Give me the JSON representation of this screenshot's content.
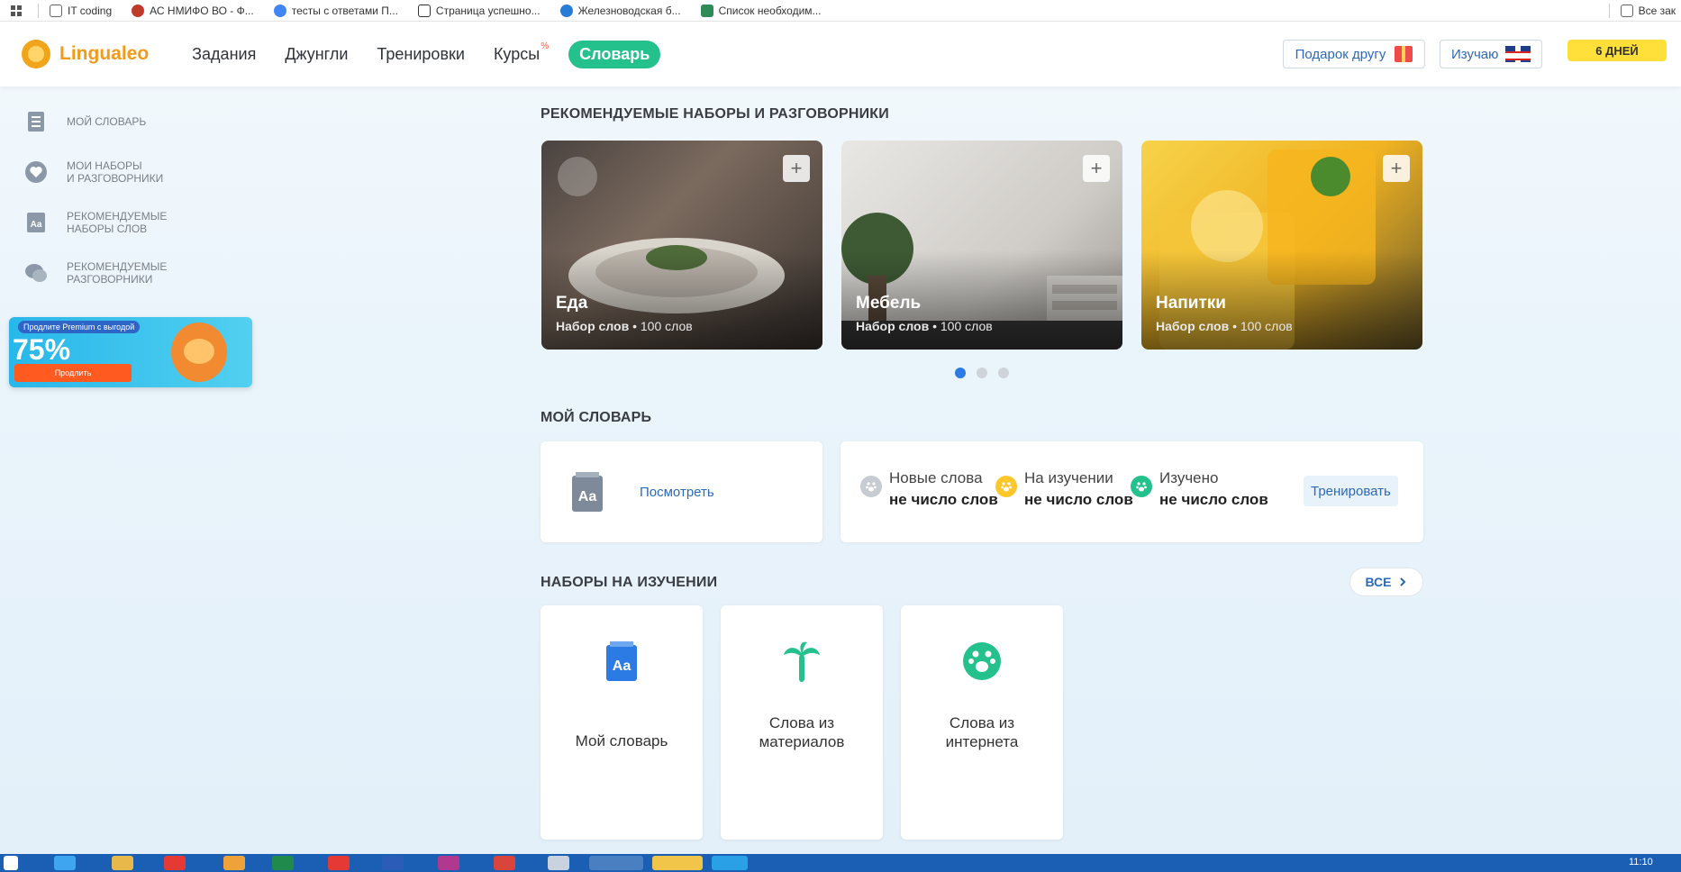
{
  "bookmarks": [
    {
      "label": "IT coding",
      "color": "#666666"
    },
    {
      "label": "АС НМИФО ВО - Ф...",
      "color": "#c0392b"
    },
    {
      "label": "тесты с ответами П...",
      "color": "#4285f4"
    },
    {
      "label": "Страница успешно...",
      "color": "#333333"
    },
    {
      "label": "Железноводская б...",
      "color": "#2a7bd6"
    },
    {
      "label": "Список необходим...",
      "color": "#2e8b57"
    }
  ],
  "bookmarks_right": "Все зак",
  "header": {
    "logo": "Lingualeo",
    "nav": [
      "Задания",
      "Джунгли",
      "Тренировки",
      "Курсы"
    ],
    "nav_badge": "%",
    "nav_active": "Словарь",
    "gift": "Подарок другу",
    "learning": "Изучаю",
    "days": "6 ДНЕЙ"
  },
  "sidebar": {
    "items": [
      {
        "label": "МОЙ СЛОВАРЬ",
        "icon": "book-icon"
      },
      {
        "label": "МОИ НАБОРЫ\nИ РАЗГОВОРНИКИ",
        "icon": "heart-icon"
      },
      {
        "label": "РЕКОМЕНДУЕМЫЕ\nНАБОРЫ СЛОВ",
        "icon": "dictionary-aa-icon"
      },
      {
        "label": "РЕКОМЕНДУЕМЫЕ\nРАЗГОВОРНИКИ",
        "icon": "chat-icon"
      }
    ],
    "promo": {
      "tag": "Продлите Premium с выгодой",
      "percent": "75%",
      "button": "Продлить"
    }
  },
  "recommended": {
    "title": "РЕКОМЕНДУЕМЫЕ НАБОРЫ И РАЗГОВОРНИКИ",
    "cards": [
      {
        "name": "Еда",
        "type": "Набор слов",
        "count": "100 слов",
        "add": "+"
      },
      {
        "name": "Мебель",
        "type": "Набор слов",
        "count": "100 слов",
        "add": "+"
      },
      {
        "name": "Напитки",
        "type": "Набор слов",
        "count": "100 слов",
        "add": "+"
      }
    ],
    "pages": 3,
    "active_page": 1
  },
  "dictionary": {
    "title": "МОЙ СЛОВАРЬ",
    "view": "Посмотреть",
    "stats": [
      {
        "label": "Новые слова",
        "value": "не число слов",
        "color": "#c7ccd3"
      },
      {
        "label": "На изучении",
        "value": "не число слов",
        "color": "#ffc72c"
      },
      {
        "label": "Изучено",
        "value": "не число слов",
        "color": "#25c18c"
      }
    ],
    "train": "Тренировать"
  },
  "learning_sets": {
    "title": "НАБОРЫ НА ИЗУЧЕНИИ",
    "all": "ВСЕ",
    "tiles": [
      {
        "label": "Мой словарь",
        "icon": "dictionary-aa-icon",
        "color": "#2c7be5"
      },
      {
        "label": "Слова из\nматериалов",
        "icon": "palm-icon",
        "color": "#25c18c"
      },
      {
        "label": "Слова из\nинтернета",
        "icon": "paw-icon",
        "color": "#25c18c"
      }
    ]
  },
  "taskbar": {
    "clock": "11:10"
  }
}
